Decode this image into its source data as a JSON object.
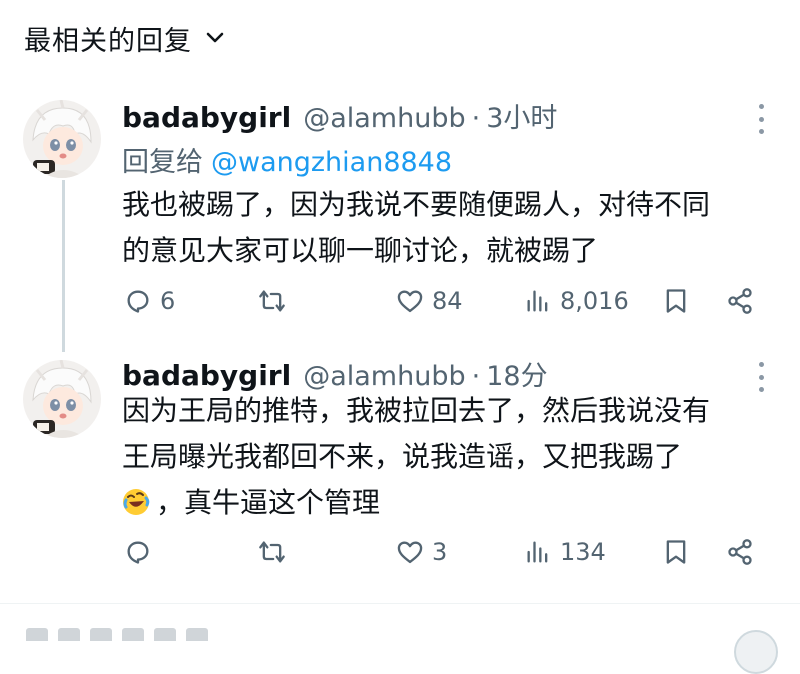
{
  "sort": {
    "label": "最相关的回复"
  },
  "replies": [
    {
      "display_name": "badabygirl",
      "handle": "@alamhubb",
      "separator": "·",
      "time": "3小时",
      "reply_to_prefix": "回复给",
      "reply_to_handle": "@wangzhian8848",
      "lines": [
        "我也被踢了，因为我说不要随便踢人，对待不同",
        "的意见大家可以聊一聊讨论，就被踢了"
      ],
      "stats": {
        "replies": "6",
        "reposts": "",
        "likes": "84",
        "views": "8,016"
      }
    },
    {
      "display_name": "badabygirl",
      "handle": "@alamhubb",
      "separator": "·",
      "time": "18分",
      "lines": [
        "因为王局的推特，我被拉回去了，然后我说没有",
        "王局曝光我都回不来，说我造谣，又把我踢了",
        "，真牛逼这个管理"
      ],
      "emoji": "rolling-on-floor-laughing",
      "stats": {
        "replies": "",
        "reposts": "",
        "likes": "3",
        "views": "134"
      }
    }
  ],
  "colors": {
    "link": "#1d9bf0",
    "muted": "#536471",
    "text": "#0f1419",
    "thread_line": "#cfd9de"
  },
  "icons": [
    "chevron-down-icon",
    "more-options-icon",
    "reply-icon",
    "repost-icon",
    "like-icon",
    "views-icon",
    "bookmark-icon",
    "share-icon",
    "rolling-laughing-emoji"
  ]
}
